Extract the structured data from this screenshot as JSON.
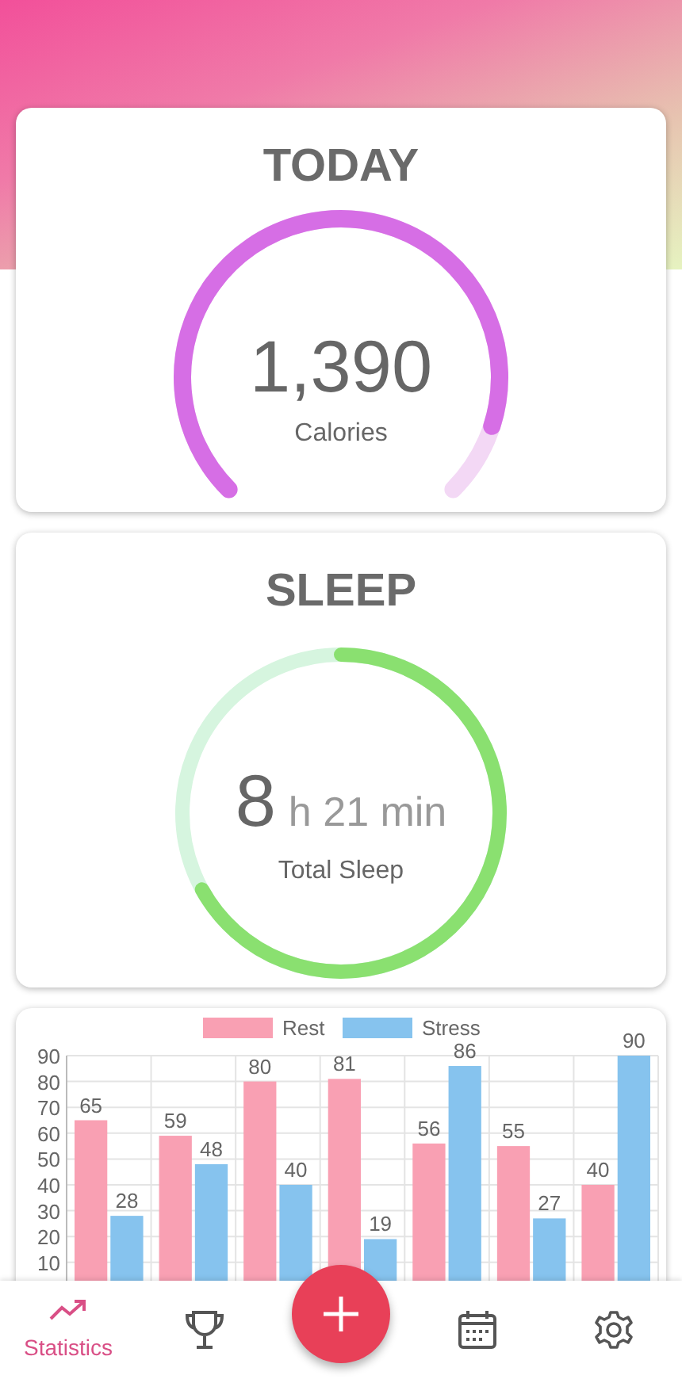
{
  "today": {
    "title": "TODAY",
    "value": "1,390",
    "label": "Calories"
  },
  "sleep": {
    "title": "SLEEP",
    "hours": "8",
    "minutes": "h 21 min",
    "label": "Total Sleep"
  },
  "chart_data": {
    "type": "bar",
    "grid": true,
    "legend": "top",
    "series": [
      {
        "name": "Rest",
        "color": "#f9a0b3",
        "values": [
          65,
          59,
          80,
          81,
          56,
          55,
          40
        ]
      },
      {
        "name": "Stress",
        "color": "#86c3ee",
        "values": [
          28,
          48,
          40,
          19,
          86,
          27,
          90
        ]
      }
    ],
    "ylim": [
      0,
      90
    ],
    "yticks": [
      10,
      20,
      30,
      40,
      50,
      60,
      70,
      80,
      90
    ],
    "data_labels": true
  },
  "nav": [
    {
      "label": "Statistics",
      "kind": "tab",
      "selected": true
    },
    {
      "kind": "tab",
      "selected": false
    },
    {
      "kind": "fab"
    },
    {
      "kind": "tab",
      "selected": false
    },
    {
      "kind": "tab",
      "selected": false
    }
  ]
}
